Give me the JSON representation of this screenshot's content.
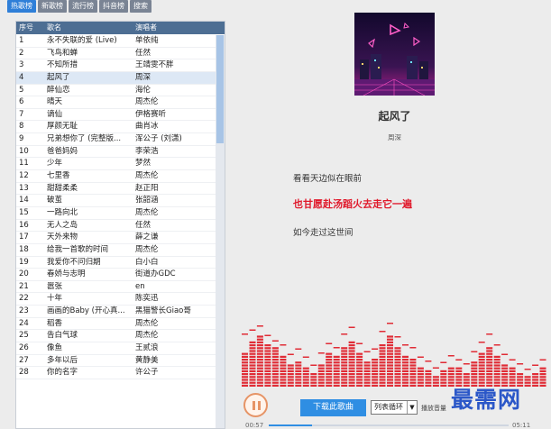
{
  "tabs": [
    "热歌榜",
    "新歌榜",
    "流行榜",
    "抖音榜",
    "搜索"
  ],
  "active_tab_index": 0,
  "list": {
    "headers": [
      "序号",
      "歌名",
      "演唱者"
    ],
    "selected_index": 3,
    "rows": [
      [
        "1",
        "永不失联的爱 (Live)",
        "单依纯"
      ],
      [
        "2",
        "飞鸟和蝉",
        "任然"
      ],
      [
        "3",
        "不知所措",
        "王靖雯不胖"
      ],
      [
        "4",
        "起风了",
        "周深"
      ],
      [
        "5",
        "醉仙恋",
        "海伦"
      ],
      [
        "6",
        "晴天",
        "周杰伦"
      ],
      [
        "7",
        "谪仙",
        "伊格赛听"
      ],
      [
        "8",
        "厚颜无耻",
        "曲肖冰"
      ],
      [
        "9",
        "兄弟想你了 (完整版...",
        "浑公子 (刘潇)"
      ],
      [
        "10",
        "爸爸妈妈",
        "李荣浩"
      ],
      [
        "11",
        "少年",
        "梦然"
      ],
      [
        "12",
        "七里香",
        "周杰伦"
      ],
      [
        "13",
        "甜甜柔柔",
        "赵正阳"
      ],
      [
        "14",
        "破茧",
        "张韶涵"
      ],
      [
        "15",
        "一路向北",
        "周杰伦"
      ],
      [
        "16",
        "无人之岛",
        "任然"
      ],
      [
        "17",
        "天外来物",
        "薛之谦"
      ],
      [
        "18",
        "给我一首歌的时间",
        "周杰伦"
      ],
      [
        "19",
        "我爱你不问归期",
        "白小白"
      ],
      [
        "20",
        "春娇与志明",
        "街道办GDC"
      ],
      [
        "21",
        "嚣张",
        "en"
      ],
      [
        "22",
        "十年",
        "陈奕迅"
      ],
      [
        "23",
        "画画的Baby (开心真...",
        "黑猫警长Giao哥"
      ],
      [
        "24",
        "稻香",
        "周杰伦"
      ],
      [
        "25",
        "告白气球",
        "周杰伦"
      ],
      [
        "26",
        "像鱼",
        "王贰浪"
      ],
      [
        "27",
        "多年以后",
        "黄静美"
      ],
      [
        "28",
        "你的名字",
        "许公子"
      ]
    ]
  },
  "now_playing": {
    "title": "起风了",
    "artist": "周深"
  },
  "lyrics": [
    "看看天边似在眼前",
    "也甘愿赴汤蹈火去走它一遍",
    "如今走过这世间"
  ],
  "controls": {
    "download_label": "下载此歌曲",
    "mode_value": "列表循环",
    "volume_label": "播放音量",
    "time_elapsed": "00:57",
    "time_total": "05:11",
    "progress_fraction": 0.18
  },
  "spectrum": {
    "bars": [
      0.55,
      0.7,
      0.78,
      0.66,
      0.6,
      0.5,
      0.35,
      0.42,
      0.3,
      0.22,
      0.38,
      0.55,
      0.48,
      0.62,
      0.72,
      0.52,
      0.4,
      0.45,
      0.68,
      0.8,
      0.6,
      0.5,
      0.44,
      0.32,
      0.28,
      0.2,
      0.26,
      0.34,
      0.3,
      0.24,
      0.4,
      0.55,
      0.62,
      0.5,
      0.38,
      0.3,
      0.25,
      0.18,
      0.22,
      0.3
    ],
    "peaks": [
      0.8,
      0.86,
      0.92,
      0.78,
      0.7,
      0.64,
      0.5,
      0.58,
      0.46,
      0.34,
      0.52,
      0.66,
      0.6,
      0.8,
      0.9,
      0.66,
      0.54,
      0.58,
      0.84,
      0.96,
      0.76,
      0.64,
      0.6,
      0.46,
      0.4,
      0.3,
      0.38,
      0.48,
      0.42,
      0.36,
      0.54,
      0.68,
      0.8,
      0.64,
      0.5,
      0.42,
      0.36,
      0.28,
      0.34,
      0.42
    ],
    "color": "#e02c36"
  },
  "watermark": "最需网",
  "icons": {
    "play_button": "pause-icon",
    "mode_dropdown": "chevron-down-icon"
  }
}
